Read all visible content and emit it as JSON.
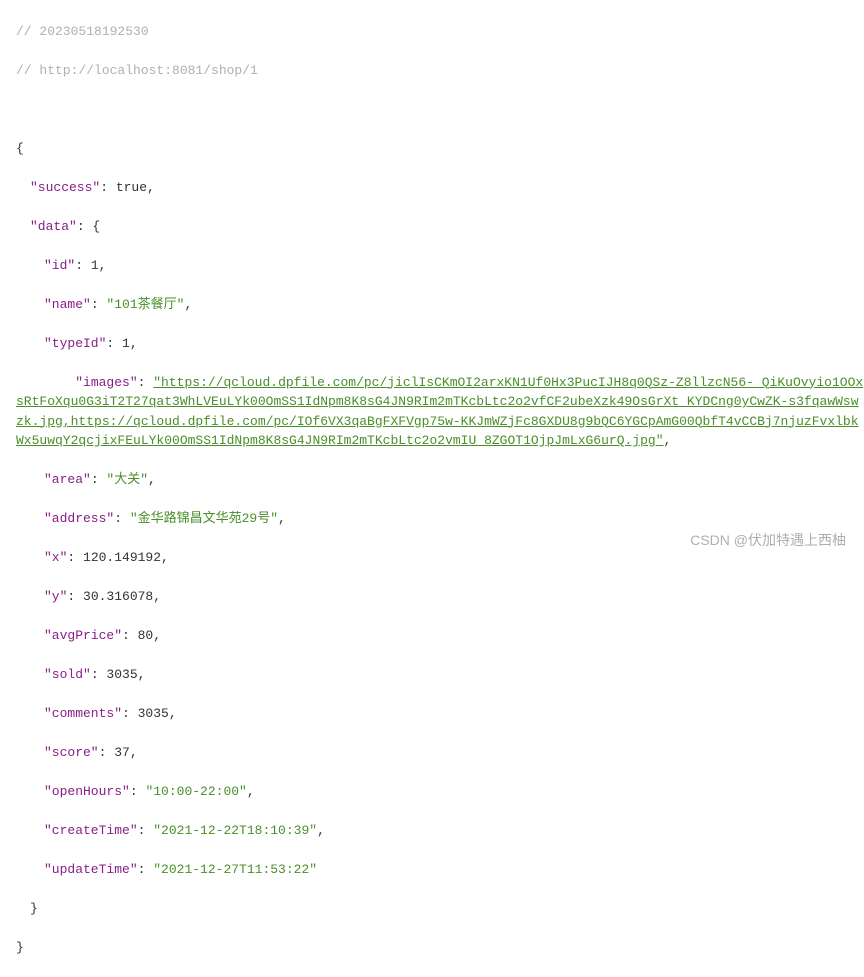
{
  "comments": {
    "timestamp": "// 20230518192530",
    "url": "// http://localhost:8081/shop/1"
  },
  "fields": {
    "success": {
      "key": "\"success\"",
      "value": "true"
    },
    "data": {
      "key": "\"data\""
    },
    "id": {
      "key": "\"id\"",
      "value": "1"
    },
    "name": {
      "key": "\"name\"",
      "value": "\"101茶餐厅\""
    },
    "typeId": {
      "key": "\"typeId\"",
      "value": "1"
    },
    "images": {
      "key": "\"images\"",
      "url_text": "\"https://qcloud.dpfile.com/pc/jiclIsCKmOI2arxKN1Uf0Hx3PucIJH8q0QSz-Z8llzcN56-_QiKuOvyio1OOxsRtFoXqu0G3iT2T27qat3WhLVEuLYk00OmSS1IdNpm8K8sG4JN9RIm2mTKcbLtc2o2vfCF2ubeXzk49OsGrXt_KYDCng0yCwZK-s3fqawWswzk.jpg,https://qcloud.dpfile.com/pc/IOf6VX3qaBgFXFVgp75w-KKJmWZjFc8GXDU8g9bQC6YGCpAmG00QbfT4vCCBj7njuzFvxlbkWx5uwqY2qcjixFEuLYk00OmSS1IdNpm8K8sG4JN9RIm2mTKcbLtc2o2vmIU_8ZGOT1OjpJmLxG6urQ.jpg\""
    },
    "area": {
      "key": "\"area\"",
      "value": "\"大关\""
    },
    "address": {
      "key": "\"address\"",
      "value": "\"金华路锦昌文华苑29号\""
    },
    "x": {
      "key": "\"x\"",
      "value": "120.149192"
    },
    "y": {
      "key": "\"y\"",
      "value": "30.316078"
    },
    "avgPrice": {
      "key": "\"avgPrice\"",
      "value": "80"
    },
    "sold": {
      "key": "\"sold\"",
      "value": "3035"
    },
    "comments_f": {
      "key": "\"comments\"",
      "value": "3035"
    },
    "score": {
      "key": "\"score\"",
      "value": "37"
    },
    "openHours": {
      "key": "\"openHours\"",
      "value": "\"10:00-22:00\""
    },
    "createTime": {
      "key": "\"createTime\"",
      "value": "\"2021-12-22T18:10:39\""
    },
    "updateTime": {
      "key": "\"updateTime\"",
      "value": "\"2021-12-27T11:53:22\""
    }
  },
  "watermark": "CSDN @伏加特遇上西柚"
}
